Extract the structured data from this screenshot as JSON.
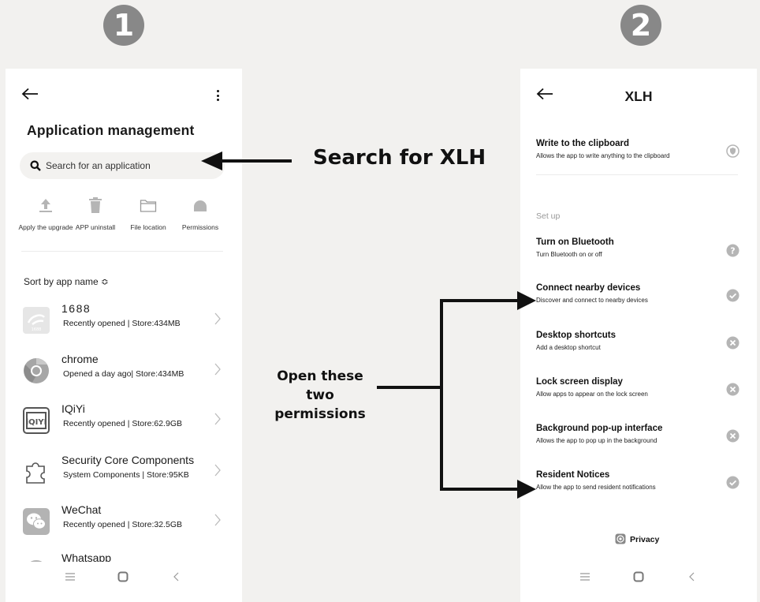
{
  "steps": {
    "one": "1",
    "two": "2"
  },
  "screen1": {
    "title": "Application management",
    "search": {
      "placeholder": "Search for an application"
    },
    "quick_actions": [
      {
        "label": "Apply the upgrade",
        "icon": "upload-icon"
      },
      {
        "label": "APP uninstall",
        "icon": "trash-icon"
      },
      {
        "label": "File location",
        "icon": "folder-icon"
      },
      {
        "label": "Permissions",
        "icon": "cloud-icon"
      }
    ],
    "sort_label": "Sort by app name ≎",
    "apps": [
      {
        "name": "1688",
        "meta": "Recently opened | Store:434MB",
        "icon": "1688-app-icon"
      },
      {
        "name": "chrome",
        "meta": "Opened a day ago| Store:434MB",
        "icon": "chrome-app-icon"
      },
      {
        "name": "IQiYi",
        "meta": "Recently opened | Store:62.9GB",
        "icon": "iqiyi-app-icon"
      },
      {
        "name": "Security Core Components",
        "meta": "System Components | Store:95KB",
        "icon": "puzzle-app-icon"
      },
      {
        "name": "WeChat",
        "meta": "Recently opened | Store:32.5GB",
        "icon": "wechat-app-icon"
      },
      {
        "name": "Whatsapp",
        "meta": "",
        "icon": "whatsapp-app-icon"
      }
    ]
  },
  "screen2": {
    "title": "XLH",
    "clipboard": {
      "title": "Write to the clipboard",
      "desc": "Allows the app to write anything to the clipboard",
      "status": "shield"
    },
    "section_label": "Set up",
    "permissions": [
      {
        "title": "Turn on Bluetooth",
        "desc": "Turn Bluetooth on or off",
        "status": "ask"
      },
      {
        "title": "Connect nearby devices",
        "desc": "Discover and connect to nearby devices",
        "status": "allowed"
      },
      {
        "title": "Desktop shortcuts",
        "desc": "Add a desktop shortcut",
        "status": "denied"
      },
      {
        "title": "Lock screen display",
        "desc": "Allow apps to appear on the lock screen",
        "status": "denied"
      },
      {
        "title": "Background pop-up interface",
        "desc": "Allows the app to pop up in the background",
        "status": "denied"
      },
      {
        "title": "Resident Notices",
        "desc": "Allow the app to send resident notifications",
        "status": "allowed"
      }
    ],
    "privacy_label": "Privacy"
  },
  "annotations": {
    "search_hint": "Search for XLH",
    "open_hint_line1": "Open these two",
    "open_hint_line2": "permissions"
  },
  "colors": {
    "background": "#f2f1ef",
    "badge": "#888888",
    "status_icon": "#b5b5b5"
  }
}
